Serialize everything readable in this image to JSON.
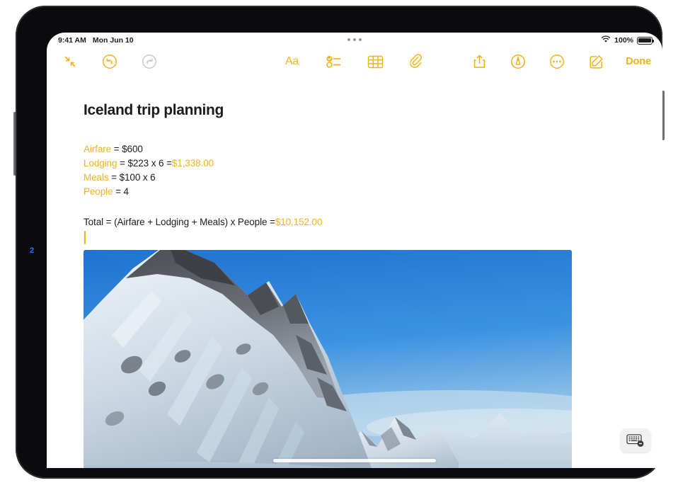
{
  "device": {
    "callout_marker": "2"
  },
  "status_bar": {
    "time": "9:41 AM",
    "date": "Mon Jun 10",
    "wifi_icon": "wifi-icon",
    "battery_percent": "100%",
    "battery_icon": "battery-icon",
    "multitask_handle_icon": "multitask-handle-icon"
  },
  "toolbar": {
    "left": [
      {
        "name": "collapse-button",
        "icon": "collapse-arrows-icon"
      },
      {
        "name": "undo-button",
        "icon": "undo-icon"
      },
      {
        "name": "redo-button",
        "icon": "redo-icon"
      }
    ],
    "center": [
      {
        "name": "format-button",
        "icon": "aa-format-icon",
        "label": "Aa"
      },
      {
        "name": "checklist-button",
        "icon": "checklist-icon"
      },
      {
        "name": "table-button",
        "icon": "table-icon"
      },
      {
        "name": "attachment-button",
        "icon": "paperclip-icon"
      }
    ],
    "right": [
      {
        "name": "share-button",
        "icon": "share-icon"
      },
      {
        "name": "markup-button",
        "icon": "markup-pen-icon"
      },
      {
        "name": "more-button",
        "icon": "ellipsis-circle-icon"
      },
      {
        "name": "compose-button",
        "icon": "compose-icon"
      }
    ],
    "done_label": "Done"
  },
  "note": {
    "title": "Iceland trip planning",
    "math_lines": [
      {
        "variable": "Airfare",
        "expression": " = $600",
        "result": ""
      },
      {
        "variable": "Lodging",
        "expression": " = $223 x 6  =",
        "result": "$1,338.00"
      },
      {
        "variable": "Meals",
        "expression": " = $100 x 6",
        "result": ""
      },
      {
        "variable": "People",
        "expression": " = 4",
        "result": ""
      }
    ],
    "total_expression": "Total = (Airfare + Lodging + Meals)  x People  =",
    "total_result": "$10,152.00",
    "attachment": {
      "name": "mountain-photo",
      "description": "Snow-covered mountain peaks under a blue sky"
    }
  },
  "bottom": {
    "dismiss_keyboard_icon": "dismiss-keyboard-icon",
    "home_indicator_icon": "home-indicator"
  },
  "colors": {
    "accent": "#efb220",
    "text": "#1c1c1e",
    "disabled": "#c6c6c8",
    "callout": "#1b7df5",
    "sky": "#2f80d8"
  }
}
